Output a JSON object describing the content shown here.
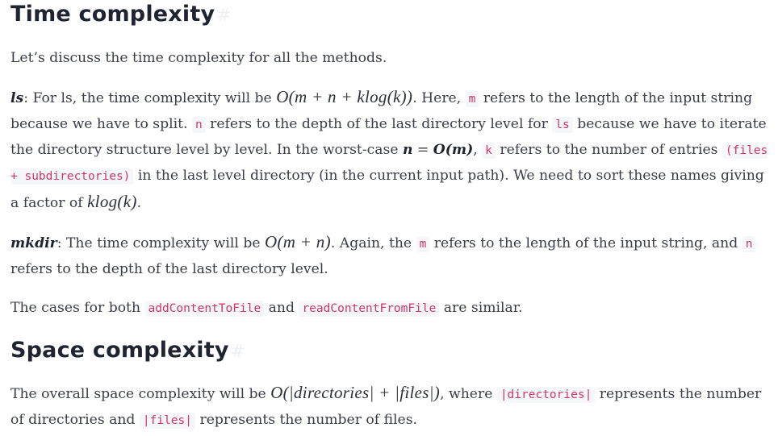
{
  "time_section": {
    "heading": "Time complexity",
    "anchor": "#",
    "intro": "Let’s discuss the time complexity for all the methods.",
    "ls": {
      "term": "ls",
      "t1": ": For ls, the time complexity will be ",
      "math1": "O(m + n + klog(k))",
      "t2": ". Here, ",
      "code_m": "m",
      "t3": " refers to the length of the input string because we have to split. ",
      "code_n": "n",
      "t4": " refers to the depth of the last directory level for ",
      "code_ls": "ls",
      "t5": " because we have to iterate the directory structure level by level. In the worst-case ",
      "bold_n": "n",
      "t6": " = ",
      "bold_om": "O(m)",
      "t7": ", ",
      "code_k": "k",
      "t8": " refers to the number of entries ",
      "code_files": "(files + subdirectories)",
      "t9": " in the last level directory (in the current input path). We need to sort these names giving a factor of ",
      "math2": "klog(k)",
      "t10": "."
    },
    "mkdir": {
      "term": "mkdir",
      "t1": ": The time complexity will be ",
      "math1": "O(m + n)",
      "t2": ". Again, the ",
      "code_m": "m",
      "t3": " refers to the length of the input string, and ",
      "code_n": "n",
      "t4": " refers to the depth of the last directory level."
    },
    "cases": {
      "t1": "The cases for both ",
      "code_add": "addContentToFile",
      "t2": " and ",
      "code_read": "readContentFromFile",
      "t3": " are similar."
    }
  },
  "space_section": {
    "heading": "Space complexity",
    "anchor": "#",
    "t1": "The overall space complexity will be ",
    "math1": "O(|directories| + |files|)",
    "t2": ", where ",
    "code_dirs": "|directories|",
    "t3": " represents the number of directories and ",
    "code_files": "|files|",
    "t4": " represents the number of files."
  }
}
